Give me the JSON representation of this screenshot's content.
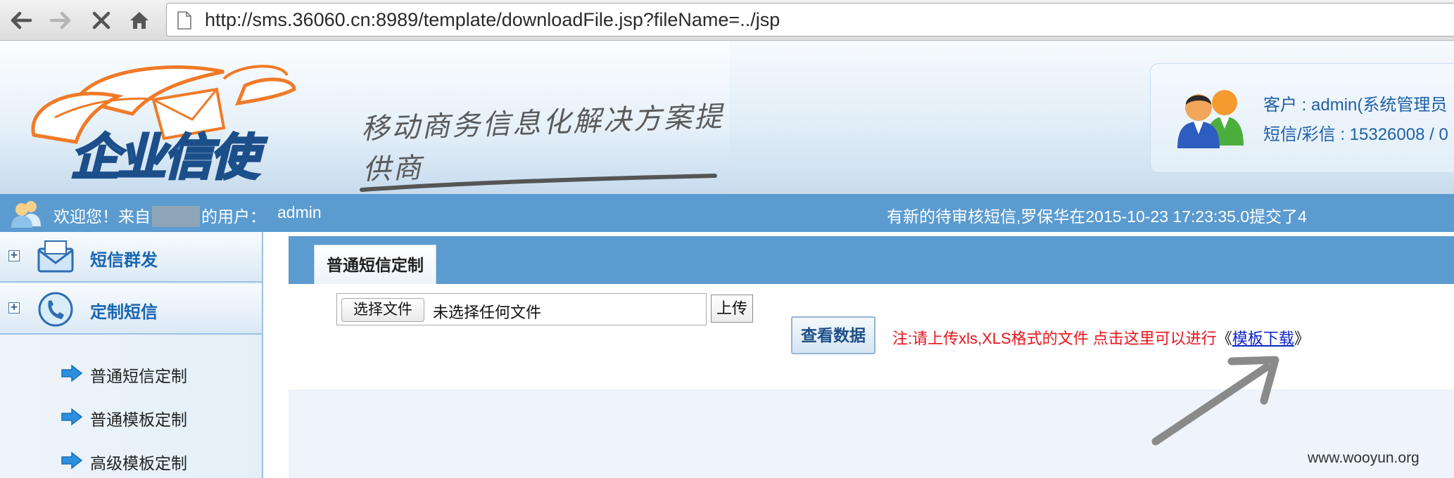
{
  "browser": {
    "url": "http://sms.36060.cn:8989/template/downloadFile.jsp?fileName=../jsp",
    "nav_icons": [
      "back-icon",
      "forward-icon",
      "stop-icon",
      "home-icon"
    ]
  },
  "header": {
    "logo_text": "企业信使",
    "slogan": "移动商务信息化解决方案提供商",
    "customer_line": "客户 : admin(系统管理员",
    "balance_line": "短信/彩信 : 15326008 / 0"
  },
  "welcome_bar": {
    "prefix": "欢迎您！来自",
    "suffix": "的用户：",
    "username": "admin",
    "notice": "有新的待审核短信,罗保华在2015-10-23 17:23:35.0提交了4"
  },
  "sidebar": {
    "groups": [
      {
        "label": "短信群发",
        "icon": "envelope-icon"
      },
      {
        "label": "定制短信",
        "icon": "phone-icon"
      }
    ],
    "sub_items": [
      {
        "label": "普通短信定制"
      },
      {
        "label": "普通模板定制"
      },
      {
        "label": "高级模板定制"
      }
    ]
  },
  "main": {
    "active_tab": "普通短信定制",
    "choose_file_label": "选择文件",
    "no_file_text": "未选择任何文件",
    "upload_label": "上传",
    "view_data_label": "查看数据",
    "note_text": "注:请上传xls,XLS格式的文件 点击这里可以进行",
    "bracket_open": "《",
    "download_link": "模板下载",
    "bracket_close": "》"
  },
  "watermark": "www.wooyun.org",
  "colors": {
    "bar_blue": "#5b9bd0",
    "link_blue": "#0c24c8",
    "note_red": "#e8141b",
    "menu_blue": "#1a66b3"
  }
}
